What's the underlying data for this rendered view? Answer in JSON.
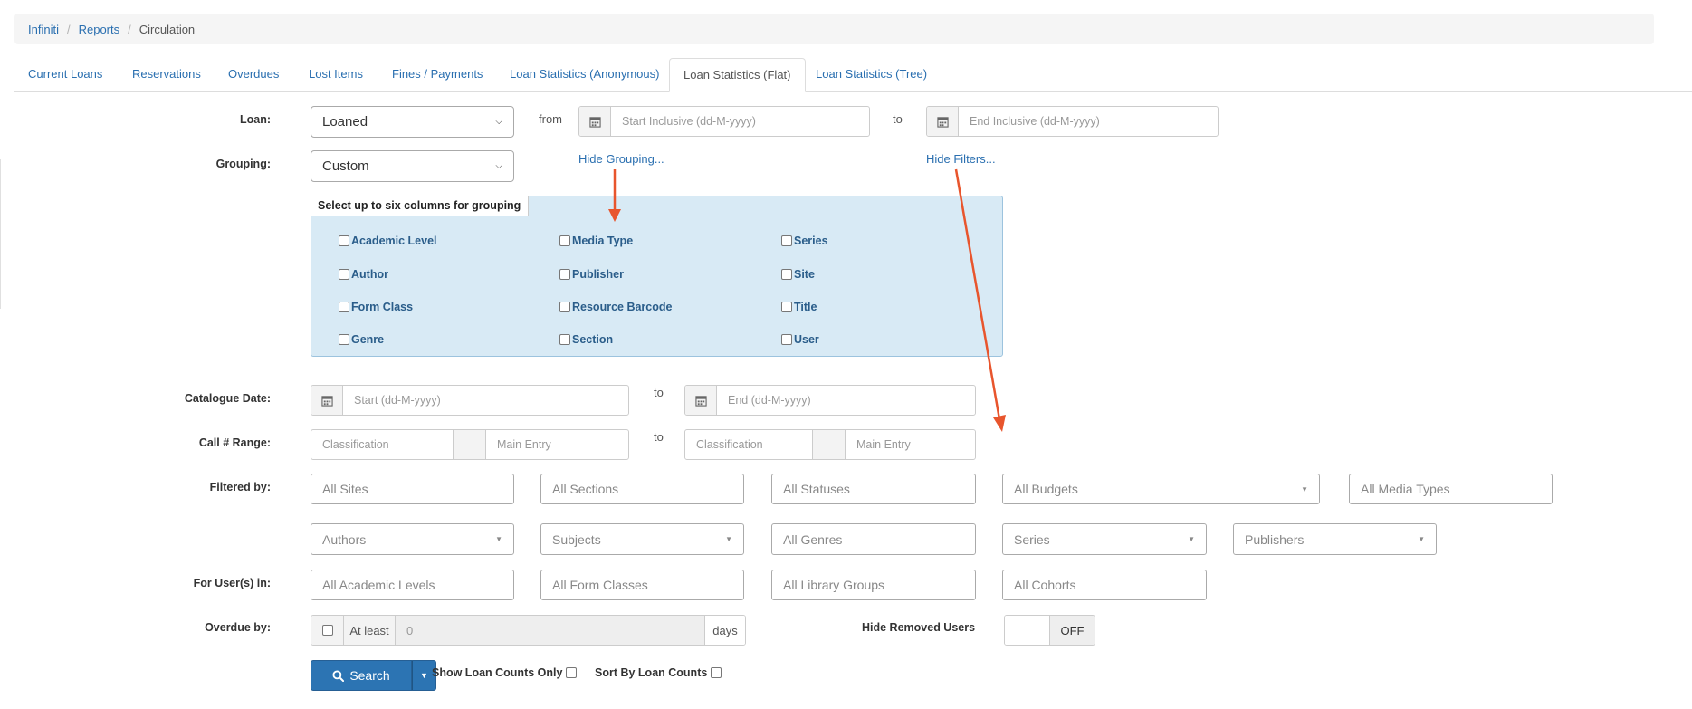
{
  "breadcrumb": {
    "items": [
      "Infiniti",
      "Reports"
    ],
    "current": "Circulation"
  },
  "tabs": [
    "Current Loans",
    "Reservations",
    "Overdues",
    "Lost Items",
    "Fines / Payments",
    "Loan Statistics (Anonymous)",
    "Loan Statistics (Flat)",
    "Loan Statistics (Tree)"
  ],
  "active_tab": "Loan Statistics (Flat)",
  "loan": {
    "label": "Loan:",
    "value": "Loaned",
    "from": "from",
    "to": "to",
    "start_placeholder": "Start Inclusive (dd-M-yyyy)",
    "end_placeholder": "End Inclusive (dd-M-yyyy)"
  },
  "grouping": {
    "label": "Grouping:",
    "value": "Custom",
    "hide_grouping": "Hide Grouping...",
    "hide_filters": "Hide Filters...",
    "box_title": "Select up to six columns for grouping",
    "columns": [
      [
        "Academic Level",
        "Author",
        "Form Class",
        "Genre"
      ],
      [
        "Media Type",
        "Publisher",
        "Resource Barcode",
        "Section"
      ],
      [
        "Series",
        "Site",
        "Title",
        "User"
      ]
    ]
  },
  "catalogue_date": {
    "label": "Catalogue Date:",
    "start": "Start (dd-M-yyyy)",
    "to": "to",
    "end": "End (dd-M-yyyy)"
  },
  "call_range": {
    "label": "Call # Range:",
    "classification": "Classification",
    "main_entry": "Main Entry",
    "to": "to"
  },
  "filtered_by": {
    "label": "Filtered by:",
    "row1": [
      "All Sites",
      "All Sections",
      "All Statuses",
      "All Budgets",
      "All Media Types"
    ],
    "row2": [
      "Authors",
      "Subjects",
      "All Genres",
      "Series",
      "Publishers"
    ]
  },
  "users_in": {
    "label": "For User(s) in:",
    "items": [
      "All Academic Levels",
      "All Form Classes",
      "All Library Groups",
      "All Cohorts"
    ]
  },
  "overdue": {
    "label": "Overdue by:",
    "at_least": "At least",
    "value": "0",
    "days": "days"
  },
  "hide_removed": {
    "label": "Hide Removed Users",
    "state": "OFF"
  },
  "actions": {
    "search": "Search",
    "show_counts": "Show Loan Counts Only",
    "sort_counts": "Sort By Loan Counts"
  },
  "colors": {
    "link": "#2a6fb0",
    "button": "#2c74b3",
    "group_bg": "#d8eaf5",
    "arrow": "#e8552d"
  }
}
